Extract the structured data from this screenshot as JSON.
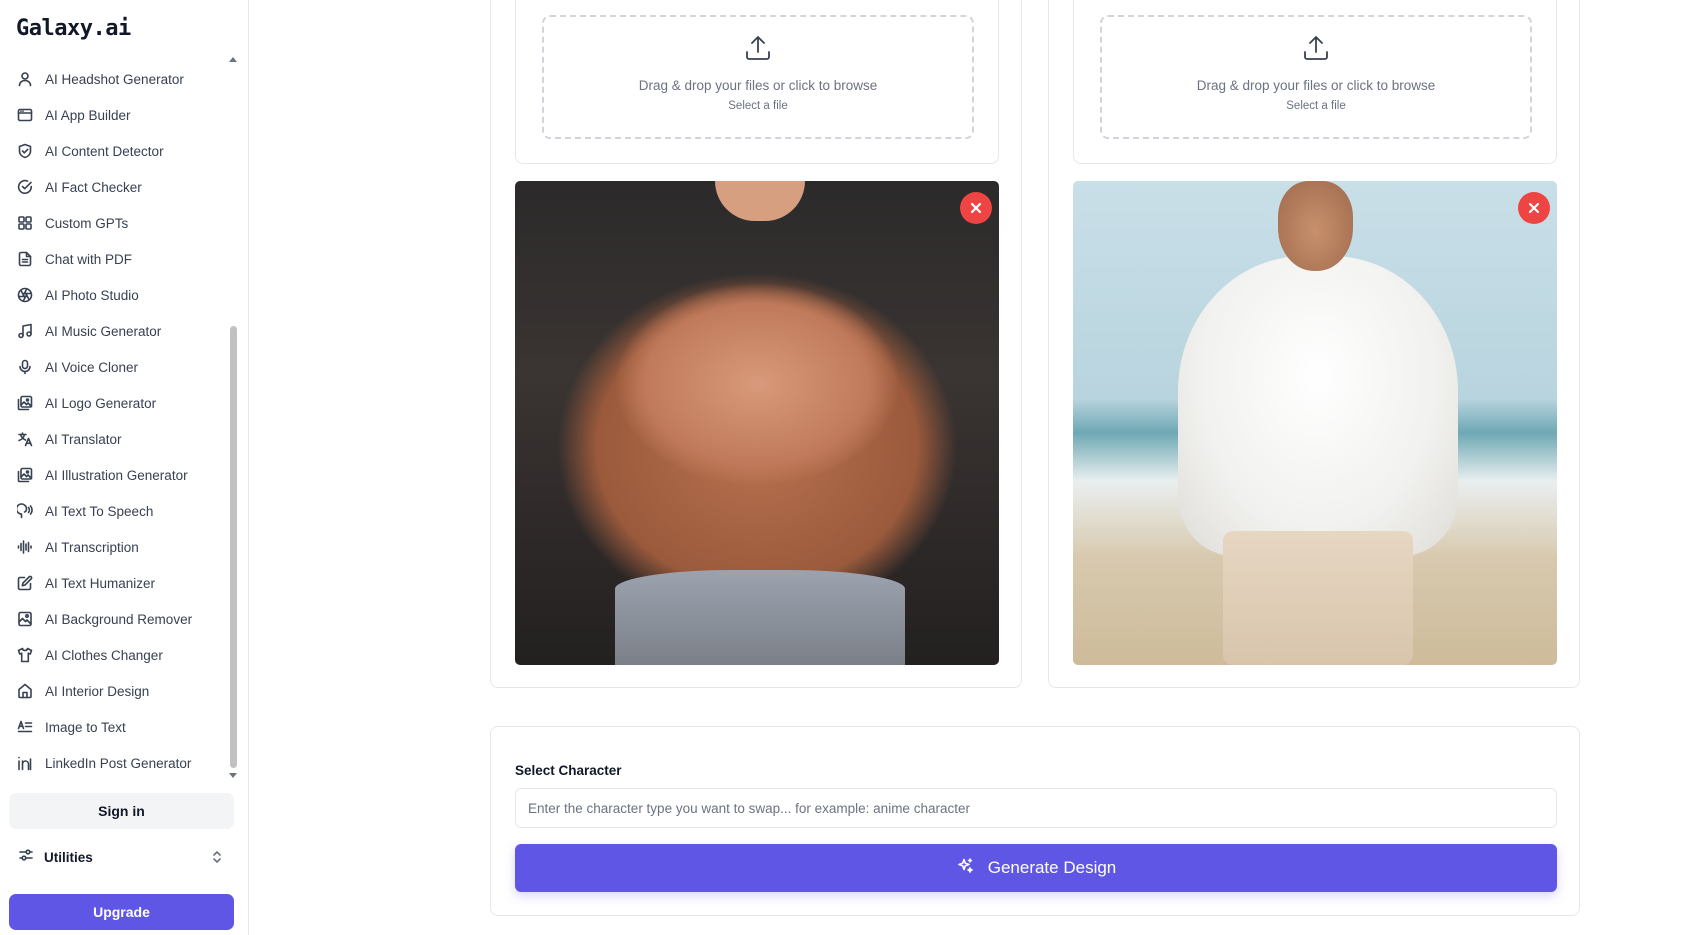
{
  "app": {
    "logo": "Galaxy.ai"
  },
  "sidebar": {
    "items": [
      {
        "label": "AI Headshot Generator",
        "icon": "user-icon"
      },
      {
        "label": "AI App Builder",
        "icon": "app-window-icon"
      },
      {
        "label": "AI Content Detector",
        "icon": "shield-check-icon"
      },
      {
        "label": "AI Fact Checker",
        "icon": "circle-check-icon"
      },
      {
        "label": "Custom GPTs",
        "icon": "grid-icon"
      },
      {
        "label": "Chat with PDF",
        "icon": "file-text-icon"
      },
      {
        "label": "AI Photo Studio",
        "icon": "aperture-icon"
      },
      {
        "label": "AI Music Generator",
        "icon": "music-icon"
      },
      {
        "label": "AI Voice Cloner",
        "icon": "mic-icon"
      },
      {
        "label": "AI Logo Generator",
        "icon": "images-icon"
      },
      {
        "label": "AI Translator",
        "icon": "languages-icon"
      },
      {
        "label": "AI Illustration Generator",
        "icon": "images-icon"
      },
      {
        "label": "AI Text To Speech",
        "icon": "speech-icon"
      },
      {
        "label": "AI Transcription",
        "icon": "audio-lines-icon"
      },
      {
        "label": "AI Text Humanizer",
        "icon": "edit-icon"
      },
      {
        "label": "AI Background Remover",
        "icon": "image-minus-icon"
      },
      {
        "label": "AI Clothes Changer",
        "icon": "shirt-icon"
      },
      {
        "label": "AI Interior Design",
        "icon": "home-icon"
      },
      {
        "label": "Image to Text",
        "icon": "text-lines-icon"
      },
      {
        "label": "LinkedIn Post Generator",
        "icon": "linkedin-icon"
      }
    ],
    "signin_label": "Sign in",
    "utilities_label": "Utilities",
    "upgrade_label": "Upgrade"
  },
  "uploads": {
    "left": {
      "drop_text": "Drag & drop your files or click to browse",
      "select_text": "Select a file"
    },
    "right": {
      "drop_text": "Drag & drop your files or click to browse",
      "select_text": "Select a file"
    }
  },
  "character": {
    "label": "Select Character",
    "placeholder": "Enter the character type you want to swap... for example: anime character",
    "value": ""
  },
  "generate_label": "Generate Design",
  "colors": {
    "accent": "#6056e6",
    "remove": "#ef4444",
    "border": "#e5e7eb"
  }
}
